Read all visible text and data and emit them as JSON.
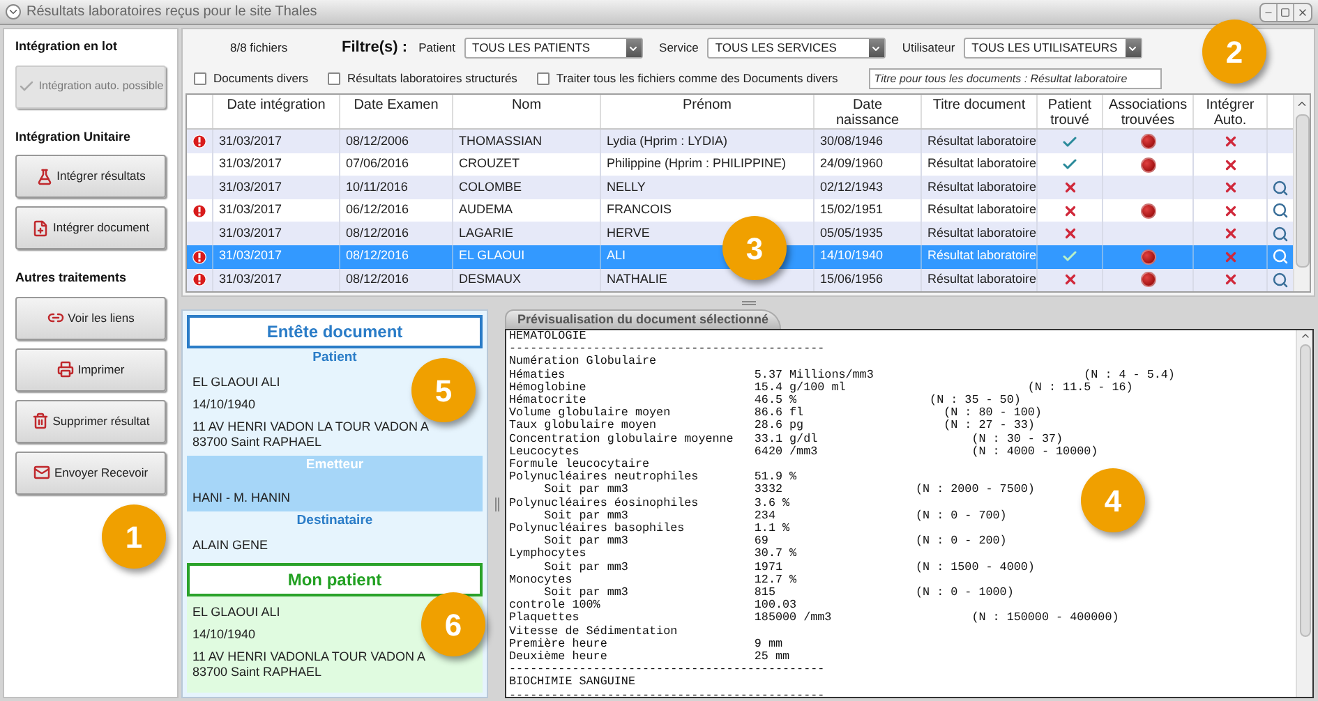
{
  "window": {
    "title": "Résultats laboratoires reçus pour le site Thales"
  },
  "sidebar": {
    "sections": [
      {
        "title": "Intégration en lot",
        "buttons": [
          {
            "label": "Intégration auto. possible",
            "disabled": true
          }
        ]
      },
      {
        "title": "Intégration Unitaire",
        "buttons": [
          {
            "label": "Intégrer résultats",
            "disabled": false
          },
          {
            "label": "Intégrer document",
            "disabled": false
          }
        ]
      },
      {
        "title": "Autres traitements",
        "buttons": [
          {
            "label": "Voir les liens",
            "disabled": false
          },
          {
            "label": "Imprimer",
            "disabled": false
          },
          {
            "label": "Supprimer résultat",
            "disabled": false
          },
          {
            "label": "Envoyer Recevoir",
            "disabled": false
          }
        ]
      }
    ]
  },
  "filters": {
    "file_count": "8/8 fichiers",
    "label": "Filtre(s) :",
    "dropdowns": [
      {
        "label": "Patient",
        "value": "TOUS LES PATIENTS"
      },
      {
        "label": "Service",
        "value": "TOUS LES SERVICES"
      },
      {
        "label": "Utilisateur",
        "value": "TOUS LES UTILISATEURS"
      }
    ],
    "checkboxes": [
      {
        "label": "Documents divers",
        "checked": false
      },
      {
        "label": "Résultats laboratoires structurés",
        "checked": false
      },
      {
        "label": "Traiter tous les fichiers comme des Documents divers",
        "checked": false
      }
    ],
    "title_field": {
      "placeholder": "Titre pour tous les documents : Résultat laboratoire"
    }
  },
  "table": {
    "columns": [
      "Date intégration",
      "Date Examen",
      "Nom",
      "Prénom",
      "Date naissance",
      "Titre document",
      "Patient trouvé",
      "Associations trouvées",
      "Intégrer Auto."
    ],
    "rows": [
      {
        "alert": true,
        "date_integration": "31/03/2017",
        "date_examen": "08/12/2006",
        "nom": "THOMASSIAN",
        "prenom": "Lydia (Hprim : LYDIA)",
        "date_naissance": "30/08/1946",
        "titre": "Résultat laboratoire",
        "patient_found": true,
        "association": true,
        "auto": false,
        "preview": false,
        "selected": false
      },
      {
        "alert": false,
        "date_integration": "31/03/2017",
        "date_examen": "07/06/2016",
        "nom": "CROUZET",
        "prenom": "Philippine (Hprim : PHILIPPINE)",
        "date_naissance": "24/09/1960",
        "titre": "Résultat laboratoire",
        "patient_found": true,
        "association": true,
        "auto": false,
        "preview": false,
        "selected": false
      },
      {
        "alert": false,
        "date_integration": "31/03/2017",
        "date_examen": "10/11/2016",
        "nom": "COLOMBE",
        "prenom": "NELLY",
        "date_naissance": "02/12/1943",
        "titre": "Résultat laboratoire",
        "patient_found": false,
        "association": false,
        "auto": false,
        "preview": true,
        "selected": false
      },
      {
        "alert": true,
        "date_integration": "31/03/2017",
        "date_examen": "06/12/2016",
        "nom": "AUDEMA",
        "prenom": "FRANCOIS",
        "date_naissance": "15/02/1951",
        "titre": "Résultat laboratoire",
        "patient_found": false,
        "association": true,
        "auto": false,
        "preview": true,
        "selected": false
      },
      {
        "alert": false,
        "date_integration": "31/03/2017",
        "date_examen": "08/12/2016",
        "nom": "LAGARIE",
        "prenom": "HERVE",
        "date_naissance": "05/05/1935",
        "titre": "Résultat laboratoire",
        "patient_found": false,
        "association": false,
        "auto": false,
        "preview": true,
        "selected": false
      },
      {
        "alert": true,
        "date_integration": "31/03/2017",
        "date_examen": "08/12/2016",
        "nom": "EL GLAOUI",
        "prenom": "ALI",
        "date_naissance": "14/10/1940",
        "titre": "Résultat laboratoire",
        "patient_found": true,
        "association": true,
        "auto": false,
        "preview": true,
        "selected": true
      },
      {
        "alert": true,
        "date_integration": "31/03/2017",
        "date_examen": "08/12/2016",
        "nom": "DESMAUX",
        "prenom": "NATHALIE",
        "date_naissance": "15/06/1956",
        "titre": "Résultat laboratoire",
        "patient_found": false,
        "association": true,
        "auto": false,
        "preview": true,
        "selected": false
      }
    ]
  },
  "document_header": {
    "title": "Entête document",
    "sections": [
      {
        "kind": "light",
        "title": "Patient",
        "lines": [
          "EL GLAOUI ALI",
          "14/10/1940",
          "11 AV HENRI VADON LA TOUR VADON A\n83700 Saint  RAPHAEL"
        ]
      },
      {
        "kind": "dark",
        "title": "Emetteur",
        "lines": [
          "HANI - M. HANIN"
        ]
      },
      {
        "kind": "light",
        "title": "Destinataire",
        "lines": [
          "ALAIN GENE"
        ]
      }
    ]
  },
  "my_patient": {
    "title": "Mon patient",
    "lines": [
      "EL GLAOUI ALI",
      "14/10/1940",
      "11 AV HENRI VADONLA TOUR VADON A\n83700 Saint  RAPHAEL"
    ]
  },
  "preview": {
    "title": "Prévisualisation du document sélectionné",
    "lines": [
      "HEMATOLOGIE",
      "---------------------------------------------",
      "Numération Globulaire",
      "Hématies                           5.37 Millions/mm3                              (N : 4 - 5.4)",
      "Hémoglobine                        15.4 g/100 ml                          (N : 11.5 - 16)",
      "Hématocrite                        46.5 %                   (N : 35 - 50)",
      "Volume globulaire moyen            86.6 fl                    (N : 80 - 100)",
      "Taux globulaire moyen              28.6 pg                    (N : 27 - 33)",
      "Concentration globulaire moyenne   33.1 g/dl                      (N : 30 - 37)",
      "Leucocytes                         6420 /mm3                      (N : 4000 - 10000)",
      "Formule leucocytaire",
      "Polynucléaires neutrophiles        51.9 %",
      "     Soit par mm3                  3332                   (N : 2000 - 7500)",
      "Polynucléaires éosinophiles        3.6 %",
      "     Soit par mm3                  234                    (N : 0 - 700)",
      "Polynucléaires basophiles          1.1 %",
      "     Soit par mm3                  69                     (N : 0 - 200)",
      "Lymphocytes                        30.7 %",
      "     Soit par mm3                  1971                   (N : 1500 - 4000)",
      "Monocytes                          12.7 %",
      "     Soit par mm3                  815                    (N : 0 - 1000)",
      "controle 100%                      100.03",
      "Plaquettes                         185000 /mm3                    (N : 150000 - 400000)",
      "Vitesse de Sédimentation",
      "Première heure                     9 mm",
      "Deuxième heure                     25 mm",
      "---------------------------------------------",
      "BIOCHIMIE SANGUINE",
      "---------------------------------------------"
    ]
  },
  "callouts": [
    "1",
    "2",
    "3",
    "4",
    "5",
    "6"
  ]
}
